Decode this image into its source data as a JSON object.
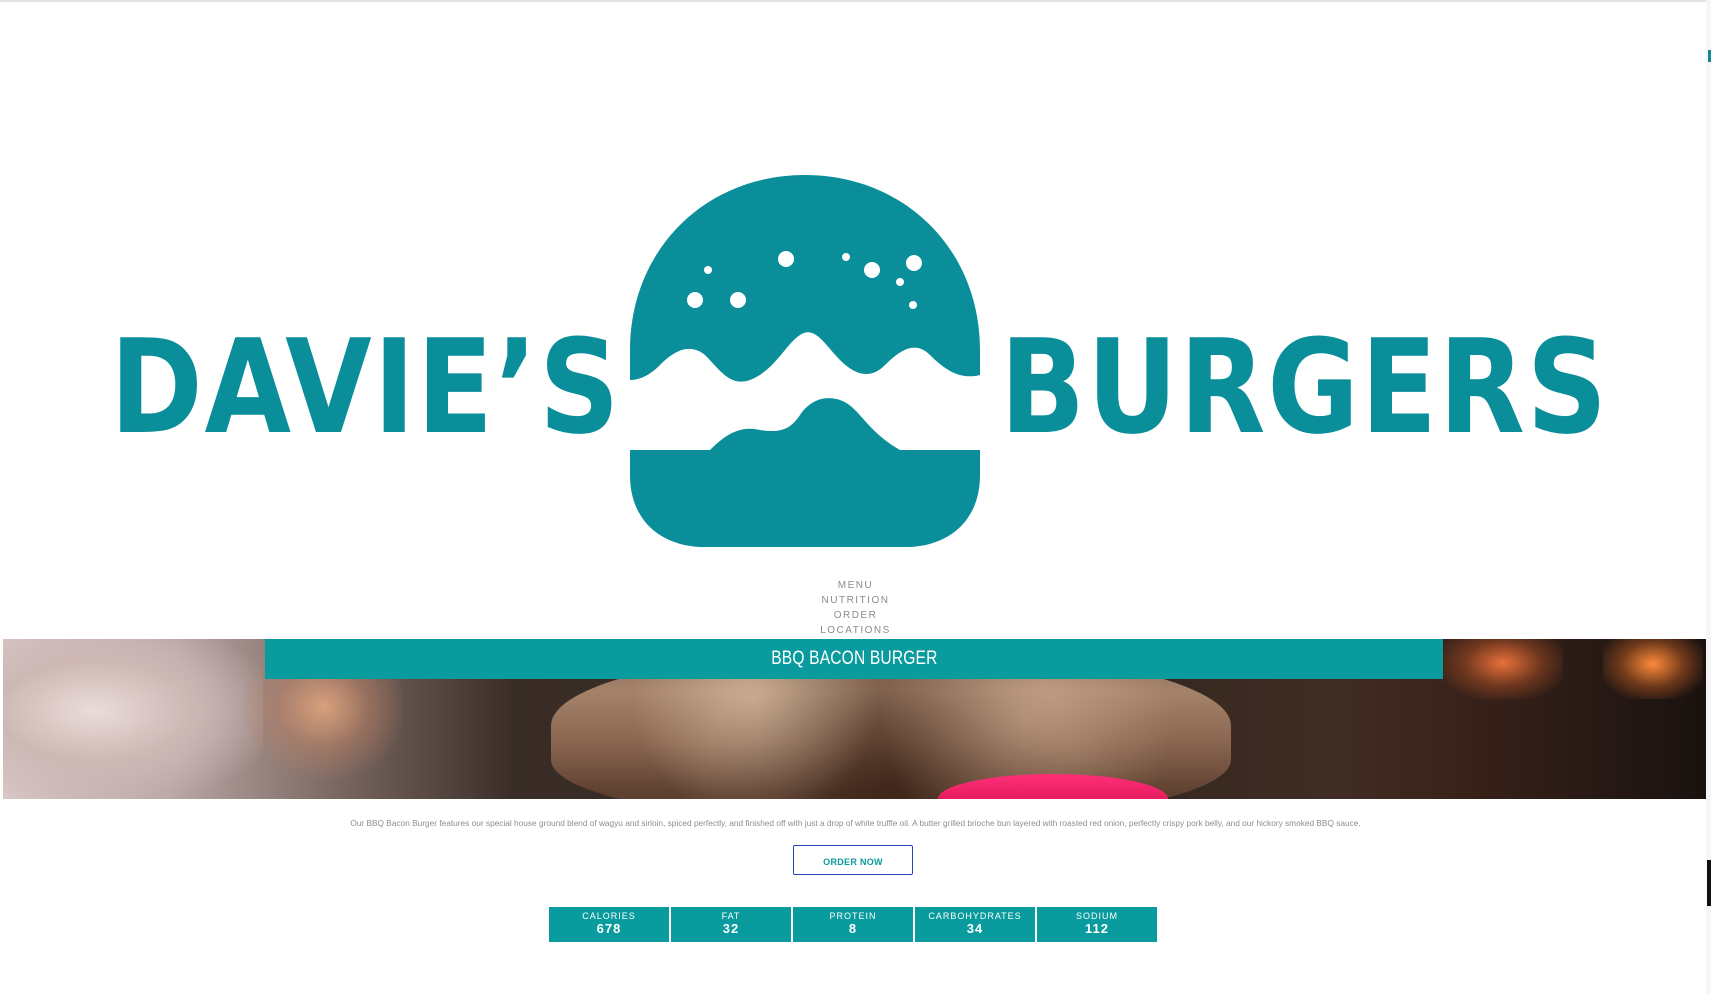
{
  "brand": {
    "word_left": "DAVIE’S",
    "word_right": "BURGERS",
    "color": "#098e9a",
    "icon": "burger-logo-icon"
  },
  "nav": {
    "items": [
      "MENU",
      "NUTRITION",
      "ORDER",
      "LOCATIONS"
    ]
  },
  "product": {
    "title": "BBQ BACON BURGER",
    "description": "Our BBQ Bacon Burger features our special house ground blend of wagyu and sirloin, spiced perfectly, and finished off with just a drop of white truffle oil. A butter grilled brioche bun layered with roasted red onion, perfectly crispy pork belly, and our hickory smoked BBQ sauce.",
    "order_label": "ORDER NOW",
    "accent_color": "#099b9d",
    "button_border_color": "#2a45b5"
  },
  "nutrition": [
    {
      "label": "CALORIES",
      "value": "678"
    },
    {
      "label": "FAT",
      "value": "32"
    },
    {
      "label": "PROTEIN",
      "value": "8"
    },
    {
      "label": "CARBOHYDRATES",
      "value": "34"
    },
    {
      "label": "SODIUM",
      "value": "112"
    }
  ]
}
